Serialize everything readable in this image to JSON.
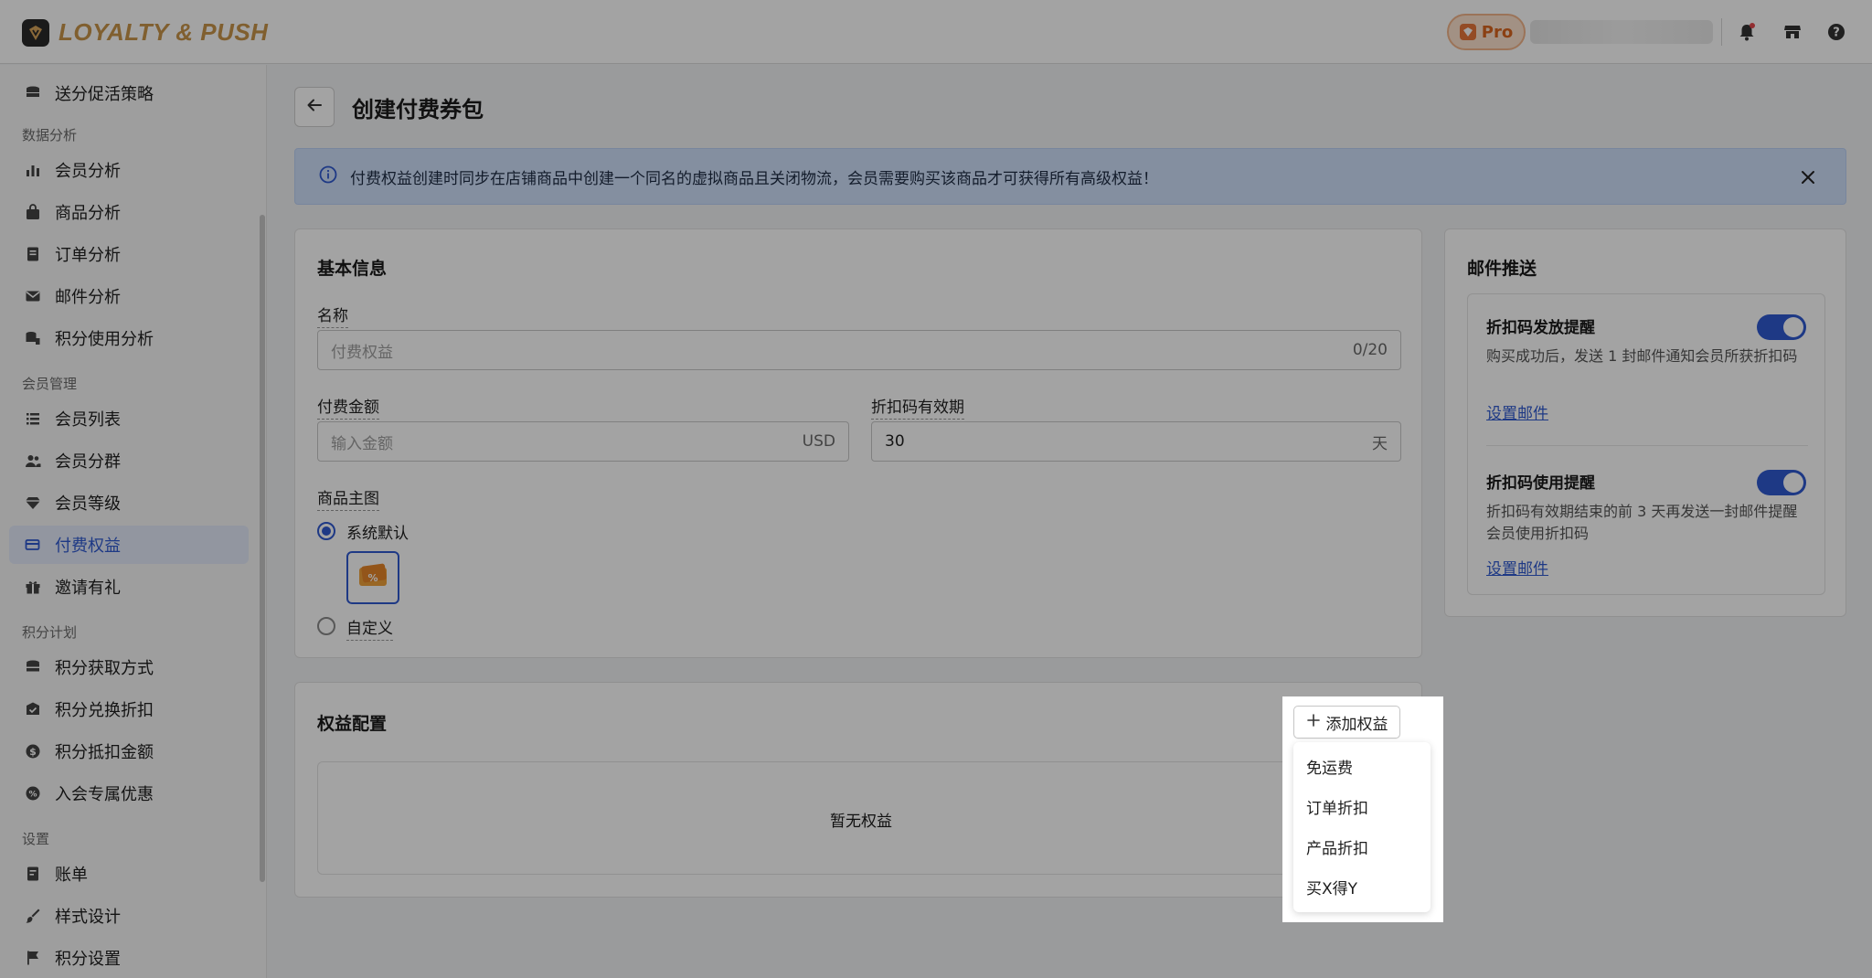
{
  "app": {
    "brand": "LOYALTY & PUSH",
    "plan_badge": "Pro"
  },
  "topbar": {
    "icons": [
      "bell-icon",
      "store-icon",
      "help-icon"
    ]
  },
  "sidebar": {
    "top_item": "送分促活策略",
    "groups": [
      {
        "title": "数据分析",
        "items": [
          "会员分析",
          "商品分析",
          "订单分析",
          "邮件分析",
          "积分使用分析"
        ]
      },
      {
        "title": "会员管理",
        "items": [
          "会员列表",
          "会员分群",
          "会员等级",
          "付费权益",
          "邀请有礼"
        ]
      },
      {
        "title": "积分计划",
        "items": [
          "积分获取方式",
          "积分兑换折扣",
          "积分抵扣金额",
          "入会专属优惠"
        ]
      },
      {
        "title": "设置",
        "items": [
          "账单",
          "样式设计",
          "积分设置"
        ]
      }
    ],
    "active_item": "付费权益"
  },
  "page": {
    "title": "创建付费券包"
  },
  "banner": {
    "text": "付费权益创建时同步在店铺商品中创建一个同名的虚拟商品且关闭物流，会员需要购买该商品才可获得所有高级权益！"
  },
  "basic_info": {
    "title": "基本信息",
    "name_label": "名称",
    "name_placeholder": "付费权益",
    "name_counter": "0/20",
    "amount_label": "付费金额",
    "amount_placeholder": "输入金额",
    "amount_suffix": "USD",
    "validity_label": "折扣码有效期",
    "validity_value": "30",
    "validity_suffix": "天",
    "image_label": "商品主图",
    "option_default": "系统默认",
    "option_custom": "自定义",
    "selected_option": "系统默认"
  },
  "benefits": {
    "title": "权益配置",
    "add_button": "添加权益",
    "empty_text": "暂无权益",
    "menu_items": [
      "免运费",
      "订单折扣",
      "产品折扣",
      "买X得Y"
    ]
  },
  "email": {
    "title": "邮件推送",
    "items": [
      {
        "title": "折扣码发放提醒",
        "desc": "购买成功后，发送 1 封邮件通知会员所获折扣码",
        "link": "设置邮件",
        "enabled": true
      },
      {
        "title": "折扣码使用提醒",
        "desc": "折扣码有效期结束的前 3 天再发送一封邮件提醒会员使用折扣码",
        "link": "设置邮件",
        "enabled": true
      }
    ]
  },
  "colors": {
    "accent": "#2f59d1",
    "brand_gold": "#c9954a",
    "pro_orange": "#e8763a",
    "banner_bg": "#cfe0fb"
  }
}
